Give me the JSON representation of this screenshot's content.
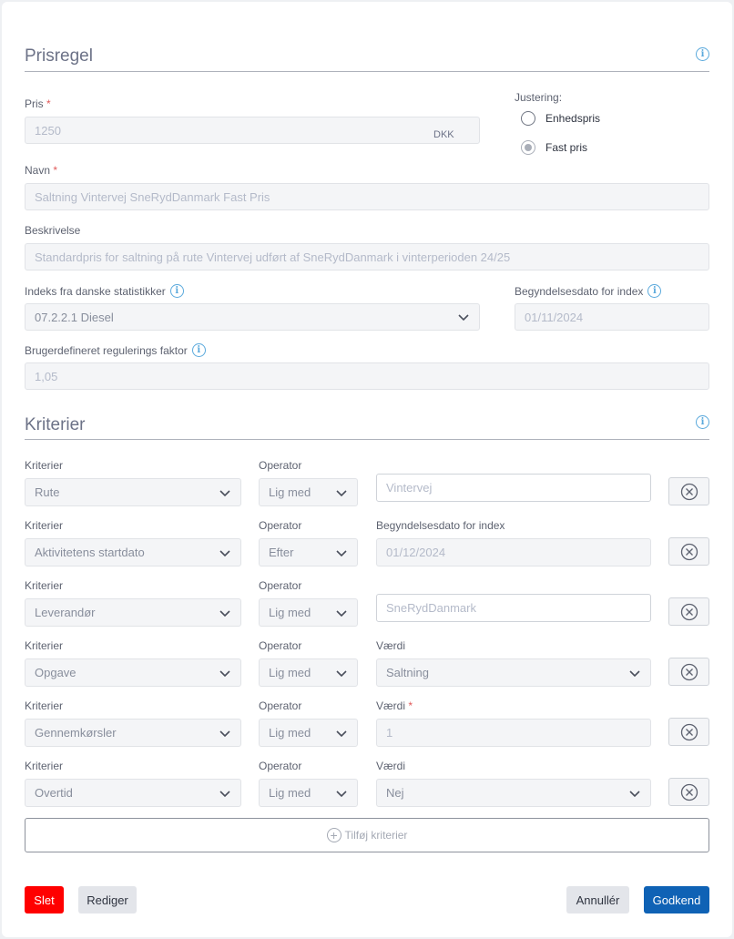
{
  "prisregel": {
    "title": "Prisregel",
    "pris": {
      "label": "Pris",
      "required": "*",
      "value": "1250",
      "unit": "DKK"
    },
    "justering": {
      "label": "Justering:",
      "options": [
        {
          "label": "Enhedspris",
          "checked": false
        },
        {
          "label": "Fast pris",
          "checked": true
        }
      ]
    },
    "navn": {
      "label": "Navn",
      "required": "*",
      "value": "Saltning Vintervej SneRydDanmark Fast Pris"
    },
    "beskrivelse": {
      "label": "Beskrivelse",
      "value": "Standardpris for saltning på rute Vintervej udført af SneRydDanmark i vinterperioden 24/25"
    },
    "indeks": {
      "label": "Indeks fra danske statistikker",
      "value": "07.2.2.1 Diesel"
    },
    "begyndelsesdato": {
      "label": "Begyndelsesdato for index",
      "value": "01/11/2024"
    },
    "faktor": {
      "label": "Brugerdefineret regulerings faktor",
      "value": "1,05"
    }
  },
  "kriterier": {
    "title": "Kriterier",
    "rows": [
      {
        "kriterier_label": "Kriterier",
        "kriterie": "Rute",
        "operator_label": "Operator",
        "operator": "Lig med",
        "value_label": "",
        "value_required": "",
        "value": "Vintervej",
        "value_type": "text-outline"
      },
      {
        "kriterier_label": "Kriterier",
        "kriterie": "Aktivitetens startdato",
        "operator_label": "Operator",
        "operator": "Efter",
        "value_label": "Begyndelsesdato for index",
        "value_required": "",
        "value": "01/12/2024",
        "value_type": "text"
      },
      {
        "kriterier_label": "Kriterier",
        "kriterie": "Leverandør",
        "operator_label": "Operator",
        "operator": "Lig med",
        "value_label": "",
        "value_required": "",
        "value": "SneRydDanmark",
        "value_type": "text-outline"
      },
      {
        "kriterier_label": "Kriterier",
        "kriterie": "Opgave",
        "operator_label": "Operator",
        "operator": "Lig med",
        "value_label": "Værdi",
        "value_required": "",
        "value": "Saltning",
        "value_type": "select"
      },
      {
        "kriterier_label": "Kriterier",
        "kriterie": "Gennemkørsler",
        "operator_label": "Operator",
        "operator": "Lig med",
        "value_label": "Værdi",
        "value_required": "*",
        "value": "1",
        "value_type": "text"
      },
      {
        "kriterier_label": "Kriterier",
        "kriterie": "Overtid",
        "operator_label": "Operator",
        "operator": "Lig med",
        "value_label": "Værdi",
        "value_required": "",
        "value": "Nej",
        "value_type": "select"
      }
    ],
    "add_label": "Tilføj kriterier"
  },
  "footer": {
    "delete_label": "Slet",
    "edit_label": "Rediger",
    "cancel_label": "Annullér",
    "approve_label": "Godkend"
  },
  "colors": {
    "accent": "#0f62b5",
    "danger": "#ff0000",
    "info": "#5aa9dc"
  }
}
